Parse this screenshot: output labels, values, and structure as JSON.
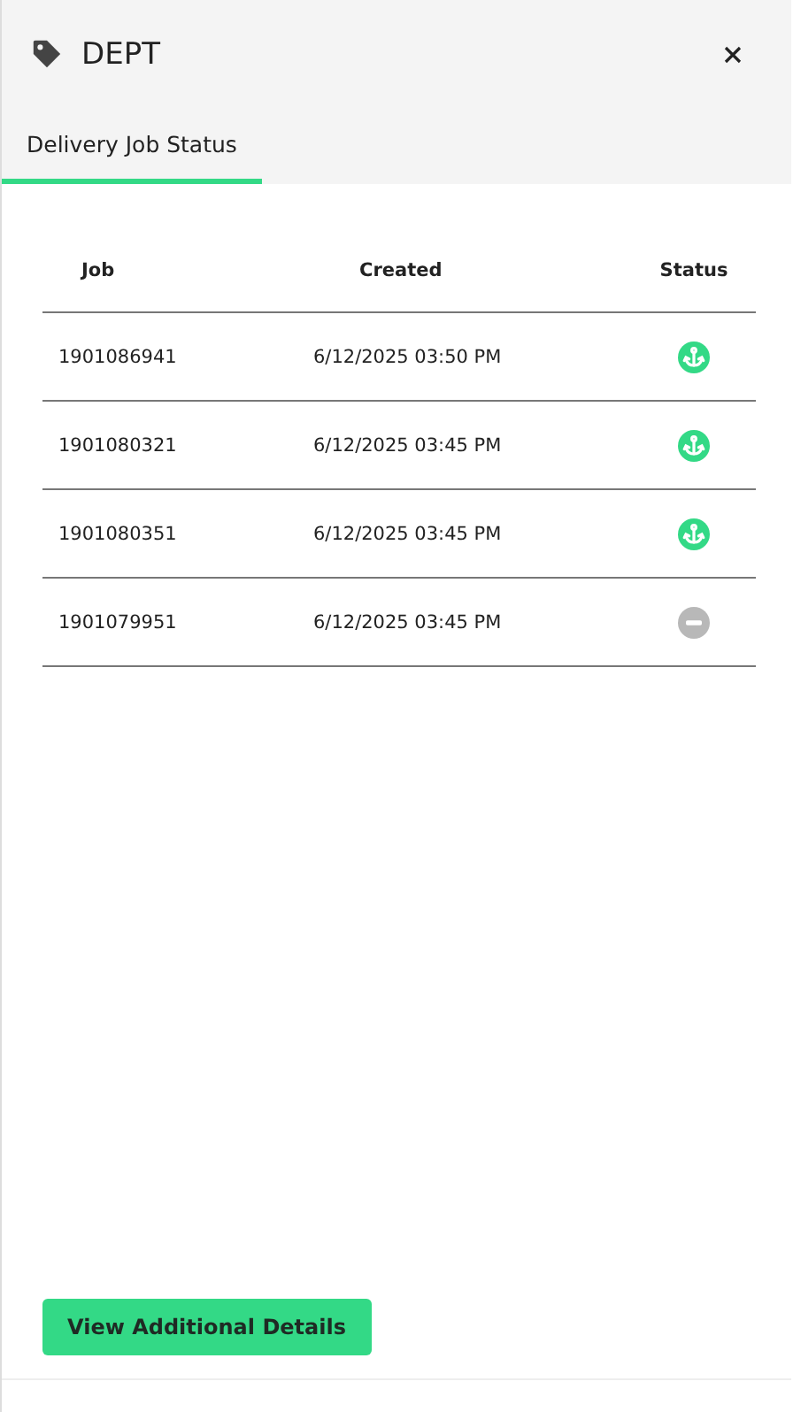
{
  "panel": {
    "title": "DEPT"
  },
  "tabs": [
    {
      "label": "Delivery Job Status",
      "selected": true
    }
  ],
  "table": {
    "columns": [
      "Job",
      "Created",
      "Status"
    ],
    "rows": [
      {
        "job": "1901086941",
        "created": "6/12/2025 03:50 PM",
        "kind": "anchor"
      },
      {
        "job": "1901080321",
        "created": "6/12/2025 03:45 PM",
        "kind": "anchor"
      },
      {
        "job": "1901080351",
        "created": "6/12/2025 03:45 PM",
        "kind": "anchor"
      },
      {
        "job": "1901079951",
        "created": "6/12/2025 03:45 PM",
        "kind": "blocked"
      }
    ]
  },
  "buttons": [
    "View Additional Details"
  ]
}
